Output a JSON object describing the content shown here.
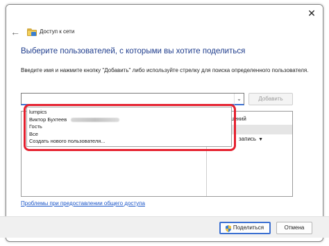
{
  "window": {
    "close_glyph": "✕",
    "back_glyph": "←"
  },
  "navbar": {
    "title": "Доступ к сети",
    "folder_icon": "network-folder-icon"
  },
  "main": {
    "heading": "Выберите пользователей, с которыми вы хотите поделиться",
    "instructions": "Введите имя и нажмите кнопку \"Добавить\" либо используйте стрелку для поиска определенного пользователя.",
    "combo_value": "",
    "add_label": "Добавить",
    "permissions_header": "зрешений",
    "permission_value": "запись"
  },
  "dropdown": {
    "items": [
      "lumpics",
      "Виктор Бухтеев",
      "Гость",
      "Все",
      "Создать нового пользователя..."
    ]
  },
  "footer": {
    "help_link": "Проблемы при предоставлении общего доступа",
    "share_label": "Поделиться",
    "cancel_label": "Отмена"
  },
  "colors": {
    "heading": "#1e3c8c",
    "link": "#1a55c8",
    "accent": "#3a6fd1",
    "highlight": "#e5202e"
  }
}
